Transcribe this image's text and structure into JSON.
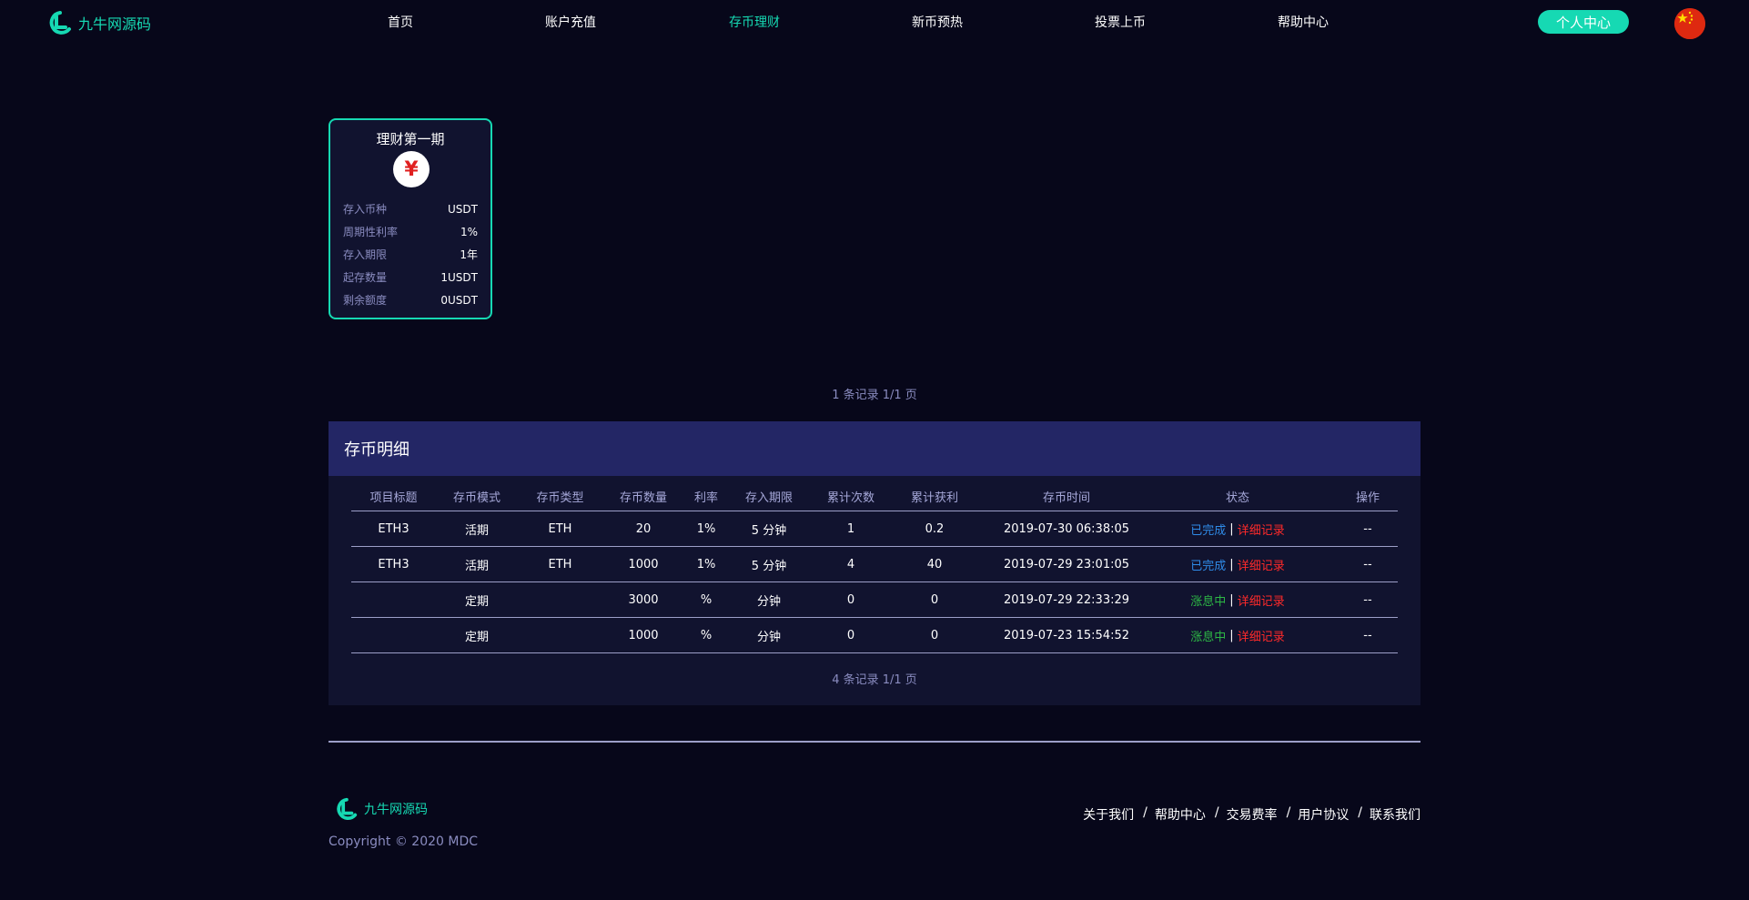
{
  "brand": {
    "name": "九牛网源码",
    "accent": "#16d9b3"
  },
  "nav": {
    "items": [
      {
        "label": "首页"
      },
      {
        "label": "账户充值"
      },
      {
        "label": "存币理财",
        "active": true
      },
      {
        "label": "新币预热"
      },
      {
        "label": "投票上币"
      },
      {
        "label": "帮助中心"
      }
    ],
    "user_center": "个人中心",
    "language_icon": "china-flag-icon"
  },
  "product": {
    "title": "理财第一期",
    "icon_symbol": "¥",
    "rows": [
      {
        "label": "存入币种",
        "value": "USDT"
      },
      {
        "label": "周期性利率",
        "value": "1%"
      },
      {
        "label": "存入期限",
        "value": "1年"
      },
      {
        "label": "起存数量",
        "value": "1USDT"
      },
      {
        "label": "剩余额度",
        "value": "0USDT"
      }
    ]
  },
  "product_pager": "1 条记录 1/1 页",
  "details": {
    "title": "存币明细",
    "columns": [
      "项目标题",
      "存币模式",
      "存币类型",
      "存币数量",
      "利率",
      "存入期限",
      "累计次数",
      "累计获利",
      "存币时间",
      "状态",
      "操作"
    ],
    "rows": [
      {
        "title": "ETH3",
        "mode": "活期",
        "type": "ETH",
        "amount": "20",
        "rate": "1%",
        "term": "5 分钟",
        "count": "1",
        "profit": "0.2",
        "time": "2019-07-30 06:38:05",
        "status": "已完成",
        "status_kind": "done",
        "detail": "详细记录",
        "op": "--"
      },
      {
        "title": "ETH3",
        "mode": "活期",
        "type": "ETH",
        "amount": "1000",
        "rate": "1%",
        "term": "5 分钟",
        "count": "4",
        "profit": "40",
        "time": "2019-07-29 23:01:05",
        "status": "已完成",
        "status_kind": "done",
        "detail": "详细记录",
        "op": "--"
      },
      {
        "title": "",
        "mode": "定期",
        "type": "",
        "amount": "3000",
        "rate": "%",
        "term": "分钟",
        "count": "0",
        "profit": "0",
        "time": "2019-07-29 22:33:29",
        "status": "涨息中",
        "status_kind": "interest",
        "detail": "详细记录",
        "op": "--"
      },
      {
        "title": "",
        "mode": "定期",
        "type": "",
        "amount": "1000",
        "rate": "%",
        "term": "分钟",
        "count": "0",
        "profit": "0",
        "time": "2019-07-23 15:54:52",
        "status": "涨息中",
        "status_kind": "interest",
        "detail": "详细记录",
        "op": "--"
      }
    ],
    "pager": "4 条记录 1/1 页",
    "separator": "|"
  },
  "footer": {
    "brand": "九牛网源码",
    "copyright": "Copyright © 2020 MDC",
    "links": [
      "关于我们",
      "帮助中心",
      "交易费率",
      "用户协议",
      "联系我们"
    ],
    "link_separator": "/"
  }
}
